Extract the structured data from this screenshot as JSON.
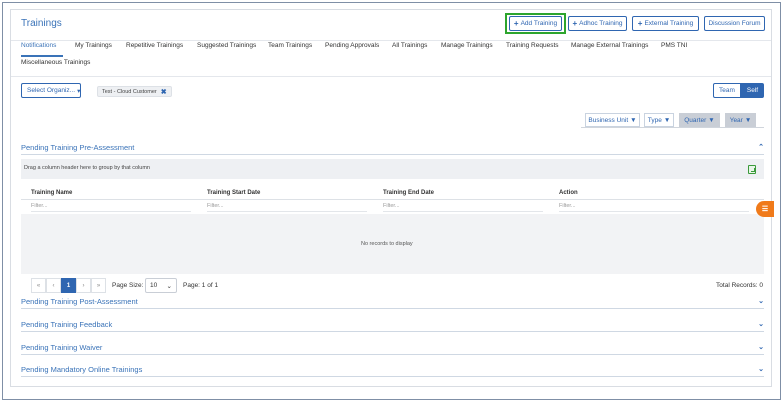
{
  "header": {
    "title": "Trainings"
  },
  "actions": [
    {
      "name": "add-training-button",
      "label": "Add Training",
      "icon": "+"
    },
    {
      "name": "adhoc-training-button",
      "label": "Adhoc Training",
      "icon": "+"
    },
    {
      "name": "external-training-button",
      "label": "External Training",
      "icon": "+"
    },
    {
      "name": "discussion-forum-button",
      "label": "Discussion Forum",
      "icon": ""
    }
  ],
  "tabs": [
    "Notifications",
    "My Trainings",
    "Repetitive Trainings",
    "Suggested Trainings",
    "Team Trainings",
    "Pending Approvals",
    "All Trainings",
    "Manage Trainings",
    "Training Requests",
    "Manage External Trainings",
    "PMS TNI",
    "Miscellaneous Trainings"
  ],
  "filters": {
    "select_org_label": "Select Organiz...",
    "chip_label": "Test - Cloud Customer",
    "team_label": "Team",
    "self_label": "Self",
    "buttons": [
      "Business Unit",
      "Type",
      "Quarter",
      "Year"
    ]
  },
  "sections": {
    "pre_assessment": "Pending Training Pre-Assessment",
    "post_assessment": "Pending Training Post-Assessment",
    "feedback": "Pending Training Feedback",
    "waiver": "Pending Training Waiver",
    "mandatory": "Pending Mandatory Online Trainings"
  },
  "grid": {
    "group_hint": "Drag a column header here to group by that column",
    "columns": [
      "Training Name",
      "Training Start Date",
      "Training End Date",
      "Action"
    ],
    "filter_placeholder": "Filter...",
    "empty_text": "No records to display",
    "pager": {
      "first": "«",
      "prev": "‹",
      "current": "1",
      "next": "›",
      "last": "»",
      "page_size_label": "Page Size:",
      "page_size": "10",
      "page_info": "Page: 1 of 1",
      "total": "Total Records: 0"
    }
  },
  "colors": {
    "accent": "#2f66b1",
    "highlight": "#2da52d",
    "side_tab": "#f07a1a"
  }
}
